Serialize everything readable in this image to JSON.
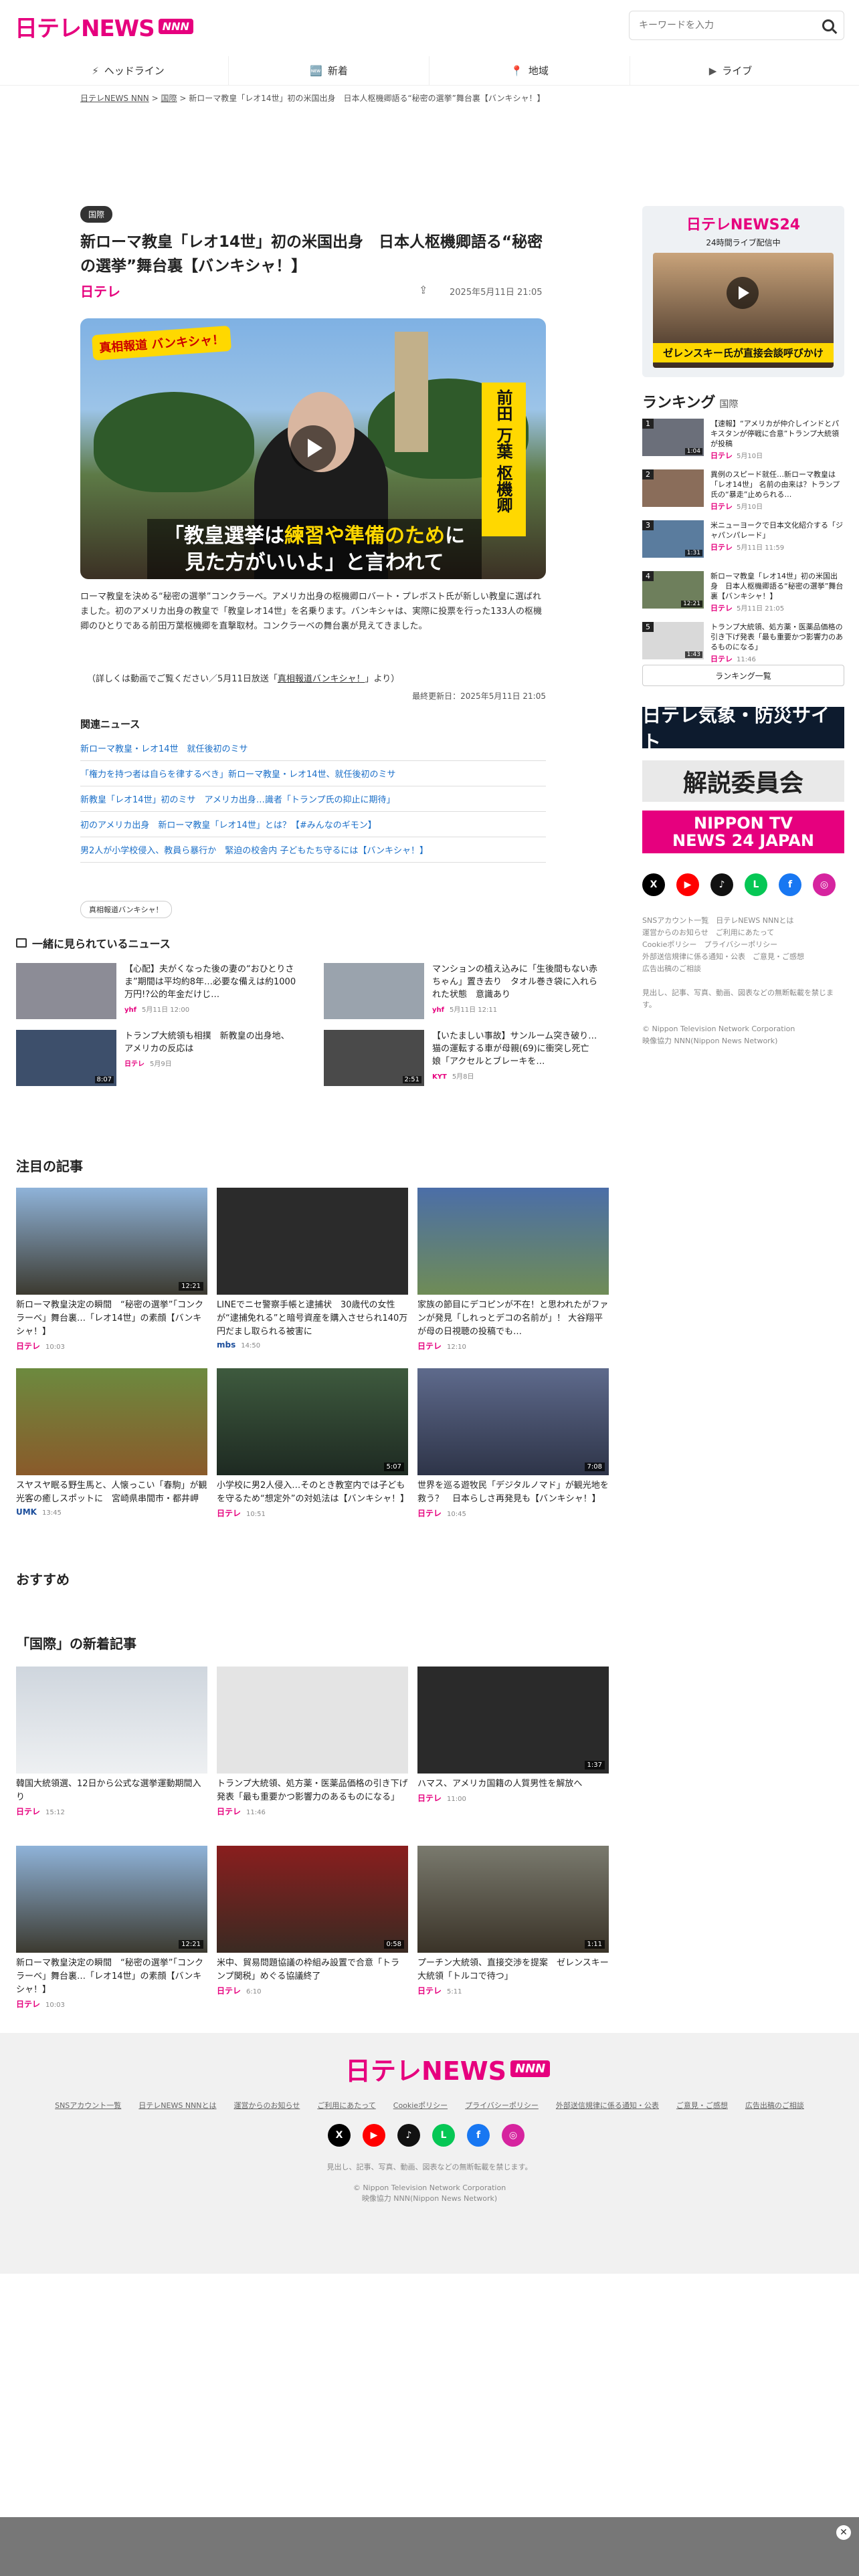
{
  "header": {
    "logo_text": "日テレNEWS",
    "logo_badge": "NNN",
    "search_placeholder": "キーワードを入力"
  },
  "nav": [
    {
      "label": "ヘッドライン",
      "icon": "lightning-icon"
    },
    {
      "label": "新着",
      "icon": "new-icon"
    },
    {
      "label": "地域",
      "icon": "map-pin-icon"
    },
    {
      "label": "ライブ",
      "icon": "live-icon"
    }
  ],
  "breadcrumb": {
    "home": "日テレNEWS NNN",
    "category": "国際",
    "current": "新ローマ教皇「レオ14世」初の米国出身　日本人枢機卿語る“秘密の選挙”舞台裏【バンキシャ！】"
  },
  "article": {
    "category": "国際",
    "title": "新ローマ教皇「レオ14世」初の米国出身　日本人枢機卿語る“秘密の選挙”舞台裏【バンキシャ！】",
    "source": "日テレ",
    "date": "2025年5月11日 21:05",
    "video_logo": "真相報道 バンキシャ！",
    "video_name": "前田 万葉 枢機卿",
    "video_sub1": "「教皇選挙は",
    "video_sub_hl": "練習や準備のため",
    "video_sub2": "に",
    "video_sub3": "見た方がいいよ」と言われて",
    "lead": "ローマ教皇を決める“秘密の選挙”コンクラーベ。アメリカ出身の枢機卿ロバート・プレボスト氏が新しい教皇に選ばれました。初のアメリカ出身の教皇で「教皇レオ14世」を名乗ります。バンキシャは、実際に投票を行った133人の枢機卿のひとりである前田万葉枢機卿を直撃取材。コンクラーベの舞台裏が見えてきました。",
    "note_pre": "（詳しくは動画でご覧ください／5月11日放送「",
    "note_link": "真相報道バンキシャ！",
    "note_post": "」より）",
    "updated": "最終更新日：2025年5月11日 21:05"
  },
  "related": {
    "heading": "関連ニュース",
    "items": [
      "新ローマ教皇・レオ14世　就任後初のミサ",
      "「権力を持つ者は自らを律するべき」新ローマ教皇・レオ14世、就任後初のミサ",
      "新教皇「レオ14世」初のミサ　アメリカ出身…識者「トランプ氏の抑止に期待」",
      "初のアメリカ出身　新ローマ教皇「レオ14世」とは？【#みんなのギモン】",
      "男2人が小学校侵入、教員ら暴行か　緊迫の校舎内 子どもたち守るには【バンキシャ！】"
    ],
    "tag": "真相報道バンキシャ！"
  },
  "sidebar": {
    "live_title": "日テレNEWS24",
    "live_sub": "24時間ライブ配信中",
    "live_caption": "ゼレンスキー氏が直接会談呼びかけ",
    "ranking_title": "ランキング",
    "ranking_cat": "国際",
    "ranking": [
      {
        "rank": "1",
        "title": "【速報】“アメリカが仲介しインドとパキスタンが停戦に合意”トランプ大統領が投稿",
        "date": "5月10日",
        "dur": "1:04"
      },
      {
        "rank": "2",
        "title": "異例のスピード就任…新ローマ教皇は「レオ14世」 名前の由来は？トランプ氏の“暴走”止められる…",
        "date": "5月10日",
        "dur": ""
      },
      {
        "rank": "3",
        "title": "米ニューヨークで日本文化紹介する「ジャパンパレード」",
        "date": "5月11日 11:59",
        "dur": "1:31"
      },
      {
        "rank": "4",
        "title": "新ローマ教皇「レオ14世」初の米国出身　日本人枢機卿語る“秘密の選挙”舞台裏【バンキシャ！】",
        "date": "5月11日 21:05",
        "dur": "12:21"
      },
      {
        "rank": "5",
        "title": "トランプ大統領、処方薬・医薬品価格の引き下げ発表「最も重要かつ影響力のあるものになる」",
        "date": "11:46",
        "dur": "1:43"
      }
    ],
    "ranking_more": "ランキング一覧",
    "banner1": "日テレ気象・防災サイト",
    "banner2": "解説委員会",
    "banner3a": "NIPPON TV",
    "banner3b": "NEWS 24 JAPAN",
    "sns": [
      "X",
      "YouTube",
      "TikTok",
      "LINE",
      "Facebook",
      "Instagram"
    ],
    "links": [
      "SNSアカウント一覧",
      "日テレNEWS NNNとは",
      "運営からのお知らせ",
      "ご利用にあたって",
      "Cookieポリシー",
      "プライバシーポリシー",
      "外部送信規律に係る通知・公表",
      "ご意見・ご感想",
      "広告出稿のご相談"
    ],
    "note": "見出し、記事、写真、動画、図表などの無断転載を禁じます。",
    "copy1": "© Nippon Television Network Corporation",
    "copy2": "映像協力 NNN(Nippon News Network)"
  },
  "also": {
    "heading": "一緒に見られているニュース",
    "items": [
      {
        "title": "【心配】夫がくなった後の妻の“おひとりさま”期間は平均約8年…必要な備えは約1000万円!?公的年金だけじ…",
        "src": "yhf",
        "date": "5月11日 12:00"
      },
      {
        "title": "マンションの植え込みに「生後間もない赤ちゃん」置き去り　タオル巻き袋に入れられた状態　意識あり",
        "src": "yhf",
        "date": "5月11日 12:11"
      },
      {
        "title": "トランプ大統領も相撲　新教皇の出身地、アメリカの反応は",
        "src": "日テレ",
        "date": "5月9日",
        "dur": "8:07"
      },
      {
        "title": "【いたましい事故】サンルーム突き破り…猫の運転する車が母親(69)に衝突し死亡　娘「アクセルとブレーキを…",
        "src": "KYT",
        "date": "5月8日",
        "dur": "2:51"
      }
    ]
  },
  "featured": {
    "heading": "注目の記事",
    "items": [
      {
        "title": "新ローマ教皇決定の瞬間　“秘密の選挙”「コンクラーベ」舞台裏…「レオ14世」の素顔【バンキシャ！】",
        "src": "日テレ",
        "date": "10:03",
        "dur": "12:21"
      },
      {
        "title": "LINEでニセ警察手帳と逮捕状　30歳代の女性が“逮捕免れる”と暗号資産を購入させられ140万円だまし取られる被害に",
        "src": "mbs",
        "date": "14:50",
        "dur": ""
      },
      {
        "title": "家族の節目にデコピンが不在！と思われたがファンが発見「しれっとデコの名前が」！ 大谷翔平が母の日視聴の投稿でも…",
        "src": "日テレ",
        "date": "12:10",
        "dur": ""
      },
      {
        "title": "スヤスヤ眠る野生馬と、人懐っこい「春駒」が観光客の癒しスポットに　宮崎県串間市・都井岬",
        "src": "UMK",
        "date": "13:45",
        "dur": ""
      },
      {
        "title": "小学校に男2人侵入…そのとき教室内では子どもを守るため“想定外”の対処法は【バンキシャ！】",
        "src": "日テレ",
        "date": "10:51",
        "dur": "5:07"
      },
      {
        "title": "世界を巡る遊牧民「デジタルノマド」が観光地を救う？　日本らしさ再発見も【バンキシャ！】",
        "src": "日テレ",
        "date": "10:45",
        "dur": "7:08"
      }
    ]
  },
  "recommend": {
    "heading": "おすすめ"
  },
  "intl": {
    "heading": "「国際」の新着記事",
    "items": [
      {
        "title": "韓国大統領選、12日から公式な選挙運動期間入り",
        "src": "日テレ",
        "date": "15:12",
        "dur": ""
      },
      {
        "title": "トランプ大統領、処方薬・医薬品価格の引き下げ発表「最も重要かつ影響力のあるものになる」",
        "src": "日テレ",
        "date": "11:46",
        "dur": ""
      },
      {
        "title": "ハマス、アメリカ国籍の人質男性を解放へ",
        "src": "日テレ",
        "date": "11:00",
        "dur": "1:37"
      },
      {
        "title": "新ローマ教皇決定の瞬間　“秘密の選挙”「コンクラーベ」舞台裏…「レオ14世」の素顔【バンキシャ！】",
        "src": "日テレ",
        "date": "10:03",
        "dur": "12:21"
      },
      {
        "title": "米中、貿易問題協議の枠組み設置で合意「トランプ関税」めぐる協議終了",
        "src": "日テレ",
        "date": "6:10",
        "dur": "0:58"
      },
      {
        "title": "プーチン大統領、直接交渉を提案　ゼレンスキー大統領「トルコで待つ」",
        "src": "日テレ",
        "date": "5:11",
        "dur": "1:11"
      }
    ]
  },
  "footer": {
    "logo_text": "日テレNEWS",
    "logo_badge": "NNN",
    "links": [
      "SNSアカウント一覧",
      "日テレNEWS NNNとは",
      "運営からのお知らせ",
      "ご利用にあたって",
      "Cookieポリシー",
      "プライバシーポリシー",
      "外部送信規律に係る通知・公表",
      "ご意見・ご感想",
      "広告出稿のご相談"
    ],
    "sns": [
      "X",
      "YouTube",
      "TikTok",
      "LINE",
      "Facebook",
      "Instagram"
    ],
    "note": "見出し、記事、写真、動画、図表などの無断転載を禁じます。",
    "copy1": "© Nippon Television Network Corporation",
    "copy2": "映像協力 NNN(Nippon News Network)"
  },
  "colors": {
    "brand": "#e6007e",
    "link": "#1b6fc8"
  }
}
